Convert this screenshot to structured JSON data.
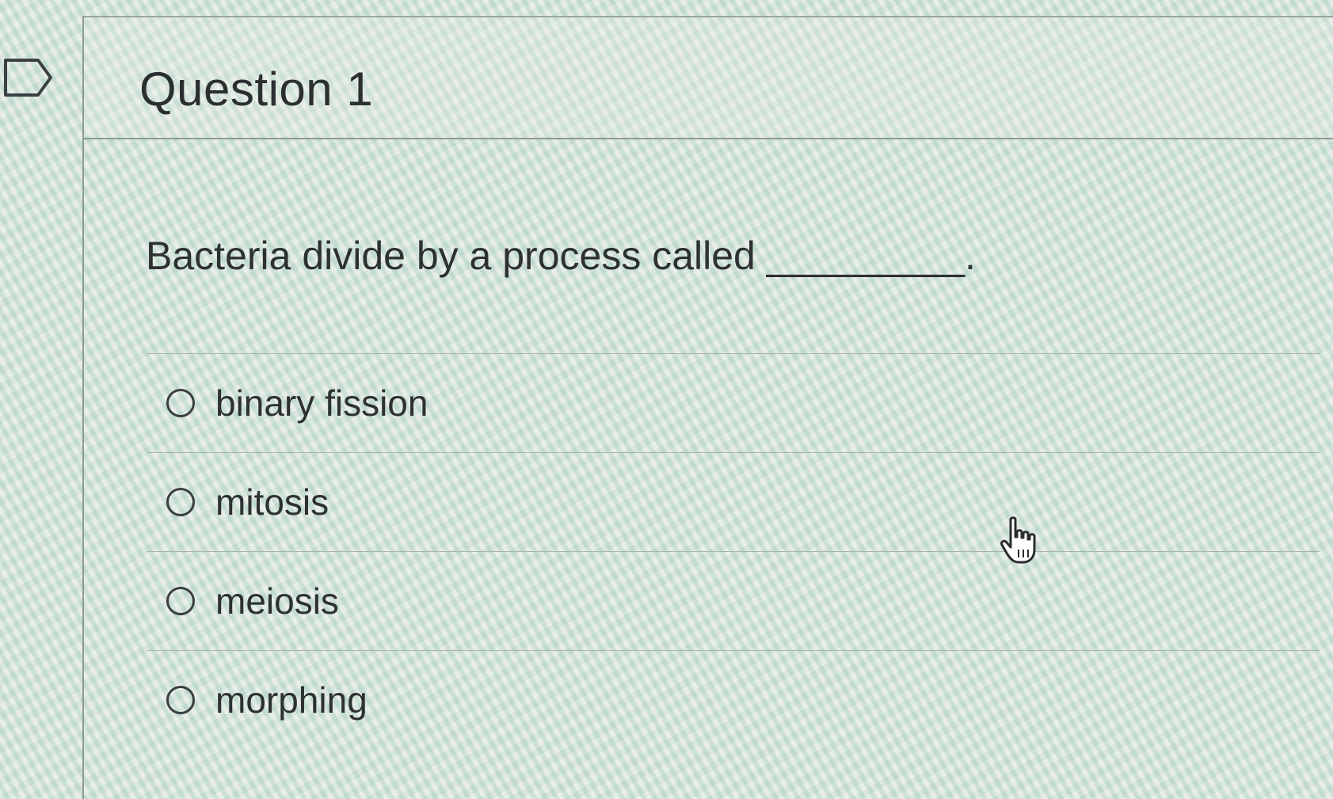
{
  "question": {
    "title": "Question 1",
    "text": "Bacteria divide by a process called _________."
  },
  "answers": [
    {
      "label": "binary fission",
      "selected": false
    },
    {
      "label": "mitosis",
      "selected": false
    },
    {
      "label": "meiosis",
      "selected": false
    },
    {
      "label": "morphing",
      "selected": false
    }
  ],
  "icons": {
    "flag": "flag-icon",
    "cursor": "hand-pointer-icon"
  }
}
